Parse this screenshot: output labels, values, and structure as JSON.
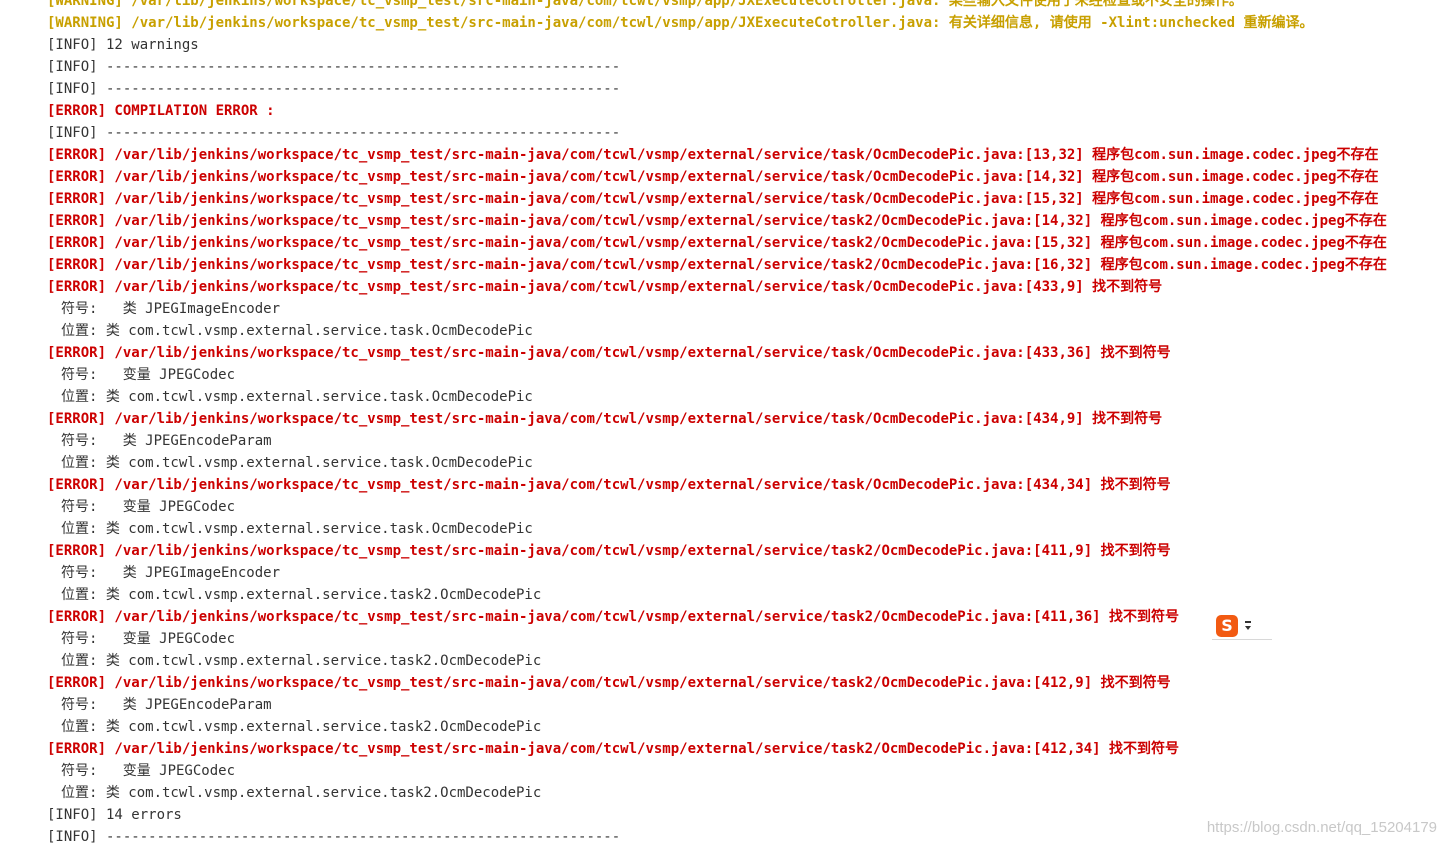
{
  "console": {
    "lines": [
      {
        "level": "WARNING",
        "text": "[WARNING] /var/lib/jenkins/workspace/tc_vsmp_test/src-main-java/com/tcwl/vsmp/app/JXExecuteCotroller.java: 某些输入文件使用了未经检查或不安全的操作。"
      },
      {
        "level": "WARNING",
        "text": "[WARNING] /var/lib/jenkins/workspace/tc_vsmp_test/src-main-java/com/tcwl/vsmp/app/JXExecuteCotroller.java: 有关详细信息, 请使用 -Xlint:unchecked 重新编译。"
      },
      {
        "level": "INFO",
        "text": "[INFO] 12 warnings"
      },
      {
        "level": "INFO",
        "text": "[INFO] -------------------------------------------------------------"
      },
      {
        "level": "INFO",
        "text": "[INFO] -------------------------------------------------------------"
      },
      {
        "level": "ERROR",
        "text": "[ERROR] COMPILATION ERROR :"
      },
      {
        "level": "INFO",
        "text": "[INFO] -------------------------------------------------------------"
      },
      {
        "level": "ERROR",
        "text": "[ERROR] /var/lib/jenkins/workspace/tc_vsmp_test/src-main-java/com/tcwl/vsmp/external/service/task/OcmDecodePic.java:[13,32] 程序包com.sun.image.codec.jpeg不存在"
      },
      {
        "level": "ERROR",
        "text": "[ERROR] /var/lib/jenkins/workspace/tc_vsmp_test/src-main-java/com/tcwl/vsmp/external/service/task/OcmDecodePic.java:[14,32] 程序包com.sun.image.codec.jpeg不存在"
      },
      {
        "level": "ERROR",
        "text": "[ERROR] /var/lib/jenkins/workspace/tc_vsmp_test/src-main-java/com/tcwl/vsmp/external/service/task/OcmDecodePic.java:[15,32] 程序包com.sun.image.codec.jpeg不存在"
      },
      {
        "level": "ERROR",
        "text": "[ERROR] /var/lib/jenkins/workspace/tc_vsmp_test/src-main-java/com/tcwl/vsmp/external/service/task2/OcmDecodePic.java:[14,32] 程序包com.sun.image.codec.jpeg不存在"
      },
      {
        "level": "ERROR",
        "text": "[ERROR] /var/lib/jenkins/workspace/tc_vsmp_test/src-main-java/com/tcwl/vsmp/external/service/task2/OcmDecodePic.java:[15,32] 程序包com.sun.image.codec.jpeg不存在"
      },
      {
        "level": "ERROR",
        "text": "[ERROR] /var/lib/jenkins/workspace/tc_vsmp_test/src-main-java/com/tcwl/vsmp/external/service/task2/OcmDecodePic.java:[16,32] 程序包com.sun.image.codec.jpeg不存在"
      },
      {
        "level": "ERROR",
        "text": "[ERROR] /var/lib/jenkins/workspace/tc_vsmp_test/src-main-java/com/tcwl/vsmp/external/service/task/OcmDecodePic.java:[433,9] 找不到符号"
      },
      {
        "level": "DETAIL",
        "text": "符号:   类 JPEGImageEncoder"
      },
      {
        "level": "DETAIL",
        "text": "位置: 类 com.tcwl.vsmp.external.service.task.OcmDecodePic"
      },
      {
        "level": "ERROR",
        "text": "[ERROR] /var/lib/jenkins/workspace/tc_vsmp_test/src-main-java/com/tcwl/vsmp/external/service/task/OcmDecodePic.java:[433,36] 找不到符号"
      },
      {
        "level": "DETAIL",
        "text": "符号:   变量 JPEGCodec"
      },
      {
        "level": "DETAIL",
        "text": "位置: 类 com.tcwl.vsmp.external.service.task.OcmDecodePic"
      },
      {
        "level": "ERROR",
        "text": "[ERROR] /var/lib/jenkins/workspace/tc_vsmp_test/src-main-java/com/tcwl/vsmp/external/service/task/OcmDecodePic.java:[434,9] 找不到符号"
      },
      {
        "level": "DETAIL",
        "text": "符号:   类 JPEGEncodeParam"
      },
      {
        "level": "DETAIL",
        "text": "位置: 类 com.tcwl.vsmp.external.service.task.OcmDecodePic"
      },
      {
        "level": "ERROR",
        "text": "[ERROR] /var/lib/jenkins/workspace/tc_vsmp_test/src-main-java/com/tcwl/vsmp/external/service/task/OcmDecodePic.java:[434,34] 找不到符号"
      },
      {
        "level": "DETAIL",
        "text": "符号:   变量 JPEGCodec"
      },
      {
        "level": "DETAIL",
        "text": "位置: 类 com.tcwl.vsmp.external.service.task.OcmDecodePic"
      },
      {
        "level": "ERROR",
        "text": "[ERROR] /var/lib/jenkins/workspace/tc_vsmp_test/src-main-java/com/tcwl/vsmp/external/service/task2/OcmDecodePic.java:[411,9] 找不到符号"
      },
      {
        "level": "DETAIL",
        "text": "符号:   类 JPEGImageEncoder"
      },
      {
        "level": "DETAIL",
        "text": "位置: 类 com.tcwl.vsmp.external.service.task2.OcmDecodePic"
      },
      {
        "level": "ERROR",
        "text": "[ERROR] /var/lib/jenkins/workspace/tc_vsmp_test/src-main-java/com/tcwl/vsmp/external/service/task2/OcmDecodePic.java:[411,36] 找不到符号"
      },
      {
        "level": "DETAIL",
        "text": "符号:   变量 JPEGCodec"
      },
      {
        "level": "DETAIL",
        "text": "位置: 类 com.tcwl.vsmp.external.service.task2.OcmDecodePic"
      },
      {
        "level": "ERROR",
        "text": "[ERROR] /var/lib/jenkins/workspace/tc_vsmp_test/src-main-java/com/tcwl/vsmp/external/service/task2/OcmDecodePic.java:[412,9] 找不到符号"
      },
      {
        "level": "DETAIL",
        "text": "符号:   类 JPEGEncodeParam"
      },
      {
        "level": "DETAIL",
        "text": "位置: 类 com.tcwl.vsmp.external.service.task2.OcmDecodePic"
      },
      {
        "level": "ERROR",
        "text": "[ERROR] /var/lib/jenkins/workspace/tc_vsmp_test/src-main-java/com/tcwl/vsmp/external/service/task2/OcmDecodePic.java:[412,34] 找不到符号"
      },
      {
        "level": "DETAIL",
        "text": "符号:   变量 JPEGCodec"
      },
      {
        "level": "DETAIL",
        "text": "位置: 类 com.tcwl.vsmp.external.service.task2.OcmDecodePic"
      },
      {
        "level": "INFO",
        "text": "[INFO] 14 errors"
      },
      {
        "level": "INFO",
        "text": "[INFO] -------------------------------------------------------------"
      }
    ]
  },
  "ime_widget": {
    "logo_letter": "S",
    "icon": "sogou-ime-icon",
    "brand_color": "#f25a12"
  },
  "watermark": {
    "text": "https://blog.csdn.net/qq_15204179"
  },
  "colors": {
    "warning": "#c8a000",
    "error": "#cc0000",
    "info": "#333333"
  }
}
